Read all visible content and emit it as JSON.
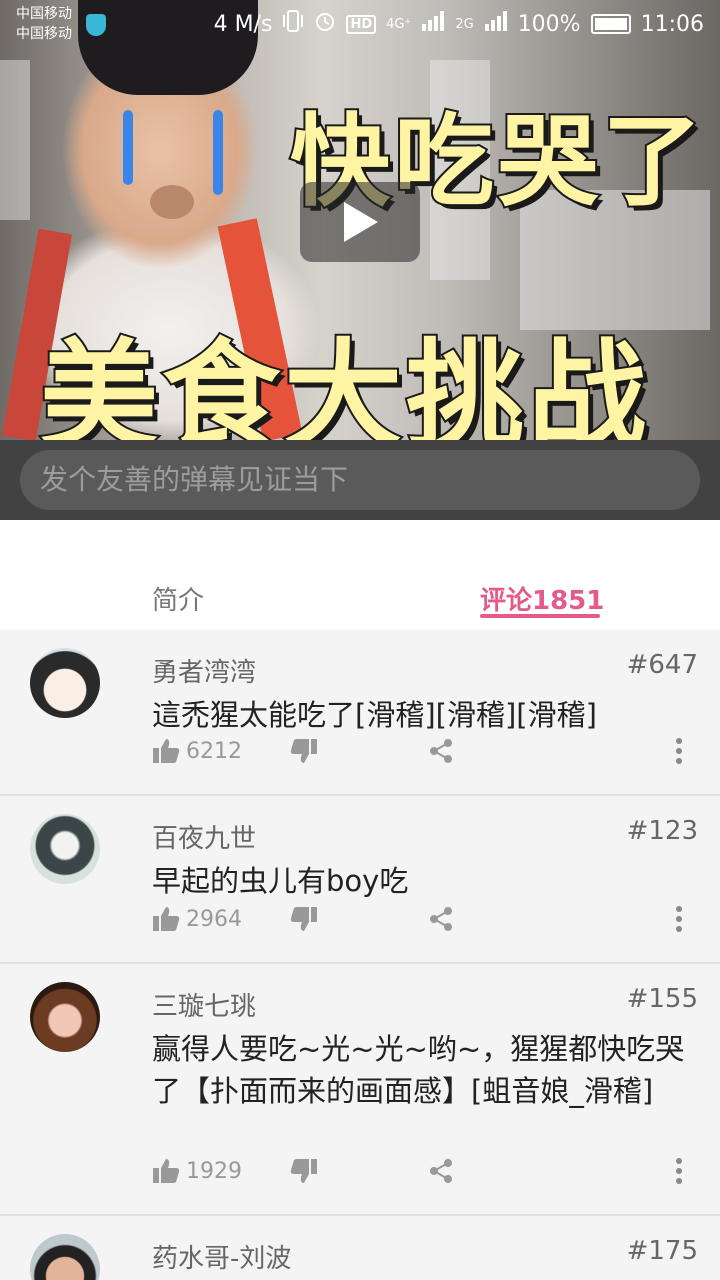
{
  "status_bar": {
    "carrier_1": "中国移动",
    "carrier_2": "中国移动",
    "speed": "4 M/s",
    "hd": "HD",
    "net_4g": "4G⁺",
    "net_2g": "2G",
    "battery": "100%",
    "time": "11:06"
  },
  "video": {
    "title_top": "快吃哭了",
    "title_bottom": "美食大挑战"
  },
  "danmaku": {
    "placeholder": "发个友善的弹幕见证当下"
  },
  "tabs": {
    "intro": "简介",
    "comments": "评论1851"
  },
  "comments": [
    {
      "user": "勇者湾湾",
      "floor": "#647",
      "text": "這禿猩太能吃了[滑稽][滑稽][滑稽]",
      "likes": "6212"
    },
    {
      "user": "百夜九世",
      "floor": "#123",
      "text": "早起的虫儿有boy吃",
      "likes": "2964"
    },
    {
      "user": "三璇七珧",
      "floor": "#155",
      "text": "赢得人要吃~光~光~哟~，猩猩都快吃哭了【扑面而来的画面感】[蛆音娘_滑稽]",
      "likes": "1929"
    },
    {
      "user": "药水哥-刘波",
      "floor": "#175",
      "text": "",
      "likes": ""
    }
  ],
  "colors": {
    "accent": "#e35a8b",
    "danmaku_bg": "#424242",
    "page_bg": "#f4f4f4"
  }
}
